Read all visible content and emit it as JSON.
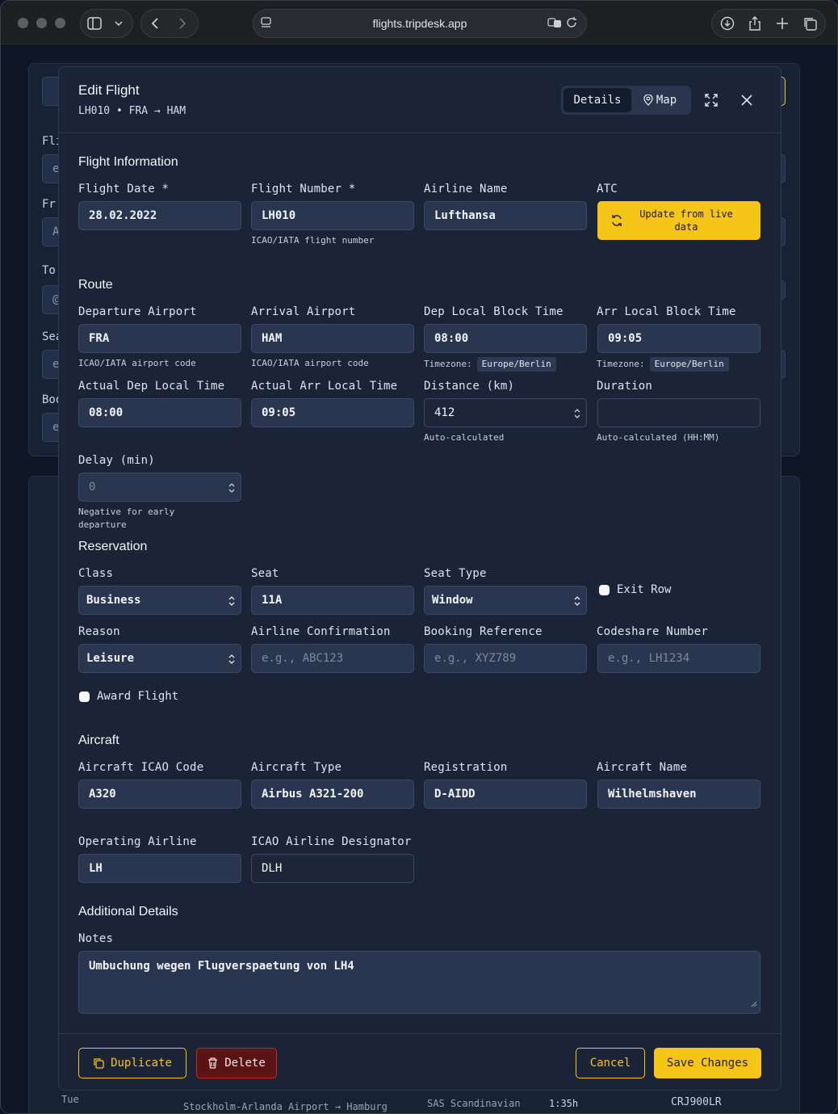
{
  "browser": {
    "url": "flights.tripdesk.app"
  },
  "background": {
    "labels": [
      "Fli",
      "Fr",
      "To",
      "Sea",
      "Boo"
    ],
    "input_fragments": [
      "e",
      "A",
      "@",
      "e",
      "e"
    ],
    "row": {
      "day": "Tue",
      "route": "Stockholm-Arlanda Airport → Hamburg",
      "airline": "SAS Scandinavian",
      "duration": "1:35h",
      "aircraft": "CRJ900LR"
    }
  },
  "modal": {
    "title": "Edit Flight",
    "subtitle": "LH010 • FRA → HAM",
    "tabs": {
      "details": "Details",
      "map": "Map"
    },
    "flight_info": {
      "title": "Flight Information",
      "date_label": "Flight Date *",
      "date_value": "28.02.2022",
      "number_label": "Flight Number *",
      "number_value": "LH010",
      "number_hint": "ICAO/IATA flight number",
      "airline_label": "Airline Name",
      "airline_value": "Lufthansa",
      "atc_label": "ATC",
      "atc_button": "Update from live data"
    },
    "route": {
      "title": "Route",
      "dep_label": "Departure Airport",
      "dep_value": "FRA",
      "dep_hint": "ICAO/IATA airport code",
      "arr_label": "Arrival Airport",
      "arr_value": "HAM",
      "arr_hint": "ICAO/IATA airport code",
      "dep_block_label": "Dep Local Block Time",
      "dep_block_value": "08:00",
      "arr_block_label": "Arr Local Block Time",
      "arr_block_value": "09:05",
      "tz_label": "Timezone:",
      "dep_tz": "Europe/Berlin",
      "arr_tz": "Europe/Berlin",
      "act_dep_label": "Actual Dep Local Time",
      "act_dep_value": "08:00",
      "act_arr_label": "Actual Arr Local Time",
      "act_arr_value": "09:05",
      "distance_label": "Distance (km)",
      "distance_value": "412",
      "distance_hint": "Auto-calculated",
      "duration_label": "Duration",
      "duration_value": "",
      "duration_hint": "Auto-calculated (HH:MM)",
      "delay_label": "Delay (min)",
      "delay_placeholder": "0",
      "delay_hint": "Negative for early departure"
    },
    "reservation": {
      "title": "Reservation",
      "class_label": "Class",
      "class_value": "Business",
      "seat_label": "Seat",
      "seat_value": "11A",
      "seat_type_label": "Seat Type",
      "seat_type_value": "Window",
      "exit_row_label": "Exit Row",
      "reason_label": "Reason",
      "reason_value": "Leisure",
      "confirmation_label": "Airline Confirmation",
      "confirmation_placeholder": "e.g., ABC123",
      "booking_label": "Booking Reference",
      "booking_placeholder": "e.g., XYZ789",
      "codeshare_label": "Codeshare Number",
      "codeshare_placeholder": "e.g., LH1234",
      "award_label": "Award Flight"
    },
    "aircraft": {
      "title": "Aircraft",
      "icao_label": "Aircraft ICAO Code",
      "icao_value": "A320",
      "type_label": "Aircraft Type",
      "type_value": "Airbus A321-200",
      "reg_label": "Registration",
      "reg_value": "D-AIDD",
      "name_label": "Aircraft Name",
      "name_value": "Wilhelmshaven",
      "op_label": "Operating Airline",
      "op_value": "LH",
      "designator_label": "ICAO Airline Designator",
      "designator_value": "DLH"
    },
    "additional": {
      "title": "Additional Details",
      "notes_label": "Notes",
      "notes_value": "Umbuchung wegen Flugverspaetung von LH4"
    },
    "footer": {
      "duplicate": "Duplicate",
      "delete": "Delete",
      "cancel": "Cancel",
      "save": "Save Changes"
    }
  }
}
